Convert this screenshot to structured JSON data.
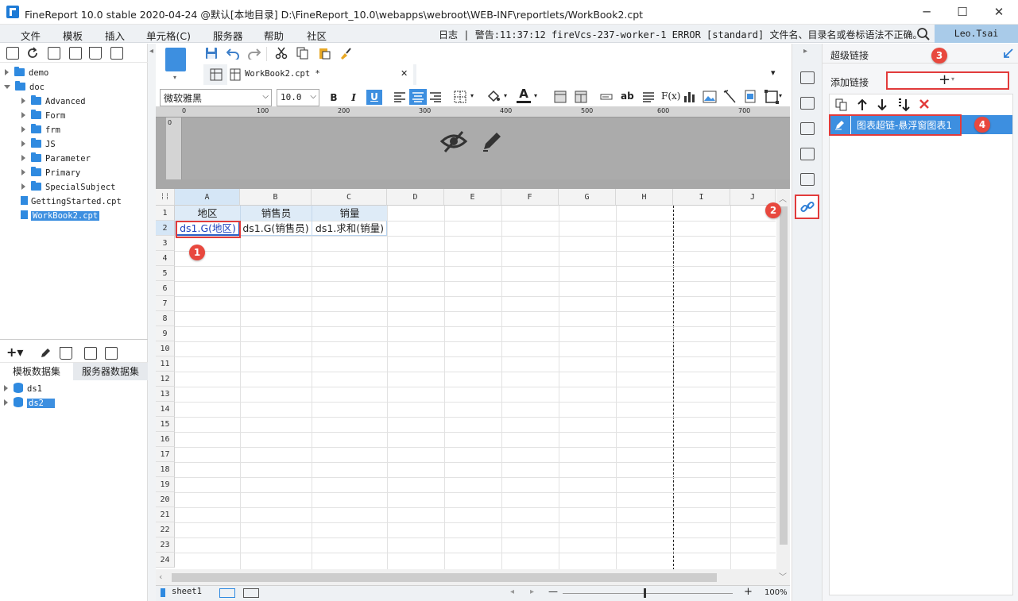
{
  "window": {
    "title": "FineReport 10.0 stable 2020-04-24 @默认[本地目录]    D:\\FineReport_10.0\\webapps\\webroot\\WEB-INF\\reportlets/WorkBook2.cpt",
    "minimize": "─",
    "maximize": "☐",
    "close": "✕"
  },
  "menu": {
    "items": [
      "文件",
      "模板",
      "插入",
      "单元格(C)",
      "服务器",
      "帮助",
      "社区"
    ],
    "log_label": "日志",
    "log_text": "警告:11:37:12 fireVcs-237-worker-1 ERROR [standard] 文件名、目录名或卷标语法不正确。",
    "user": "Leo.Tsai"
  },
  "tree": {
    "items": [
      {
        "label": "demo",
        "type": "folder",
        "expanded": false,
        "level": 0
      },
      {
        "label": "doc",
        "type": "folder",
        "expanded": true,
        "level": 0
      },
      {
        "label": "Advanced",
        "type": "folder",
        "expanded": false,
        "level": 1
      },
      {
        "label": "Form",
        "type": "folder",
        "expanded": false,
        "level": 1
      },
      {
        "label": "frm",
        "type": "folder",
        "expanded": false,
        "level": 1
      },
      {
        "label": "JS",
        "type": "folder",
        "expanded": false,
        "level": 1
      },
      {
        "label": "Parameter",
        "type": "folder",
        "expanded": false,
        "level": 1
      },
      {
        "label": "Primary",
        "type": "folder",
        "expanded": false,
        "level": 1
      },
      {
        "label": "SpecialSubject",
        "type": "folder",
        "expanded": false,
        "level": 1
      },
      {
        "label": "GettingStarted.cpt",
        "type": "file",
        "level": 0
      },
      {
        "label": "WorkBook2.cpt",
        "type": "file",
        "level": 0,
        "selected": true
      }
    ]
  },
  "datasets": {
    "tab_template": "模板数据集",
    "tab_server": "服务器数据集",
    "items": [
      {
        "label": "ds1",
        "selected": false
      },
      {
        "label": "ds2",
        "selected": true
      }
    ],
    "add_icon": "+▾"
  },
  "editor": {
    "tab_label": "WorkBook2.cpt *",
    "tab_close": "✕",
    "font_name": "微软雅黑",
    "font_size": "10.0",
    "bold": "B",
    "italic": "I",
    "underline": "U",
    "text_color_symbol": "A",
    "fx_label": "F(x)",
    "ab_label": "ab"
  },
  "ruler": {
    "ticks": [
      "0",
      "100",
      "200",
      "300",
      "400",
      "500",
      "600",
      "700"
    ],
    "vertical_tick": "0"
  },
  "sheet": {
    "columns": [
      "A",
      "B",
      "C",
      "D",
      "E",
      "F",
      "G",
      "H",
      "I",
      "J"
    ],
    "rows": [
      "1",
      "2",
      "3",
      "4",
      "5",
      "6",
      "7",
      "8",
      "9",
      "10",
      "11",
      "12",
      "13",
      "14",
      "15",
      "16",
      "17",
      "18",
      "19",
      "20",
      "21",
      "22",
      "23",
      "24"
    ],
    "cells": {
      "A1": "地区",
      "B1": "销售员",
      "C1": "销量",
      "A2": "ds1.G(地区)",
      "B2": "ds1.G(销售员)",
      "C2": "ds1.求和(销量)"
    },
    "sheet_tab": "sheet1",
    "zoom": "100%",
    "zoom_minus": "—",
    "zoom_plus": "+"
  },
  "hyperlink_panel": {
    "title": "超级链接",
    "add_label": "添加链接",
    "add_button": "+",
    "item": "图表超链-悬浮窗图表1"
  },
  "annotations": [
    "1",
    "2",
    "3",
    "4"
  ],
  "colors": {
    "accent": "#3d8fe0",
    "annotation": "#e8483e",
    "selected_cell_text": "#1b3fbf",
    "ruler_bg": "#a8a8a8"
  }
}
